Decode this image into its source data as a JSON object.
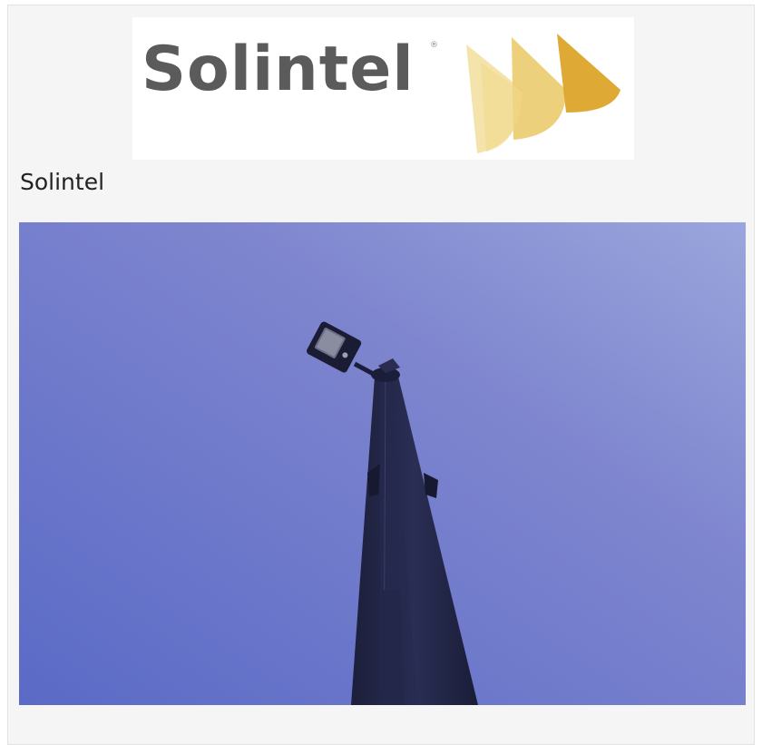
{
  "brand": {
    "logo_text": "Solintel",
    "logo_mark": "®",
    "name": "Solintel"
  },
  "photo": {
    "subject": "solar street lamp pole against blue sky"
  },
  "colors": {
    "logo_text": "#5b5b5b",
    "logo_gold_light": "#f0dc9c",
    "logo_gold_mid": "#e8c25a",
    "logo_gold_dark": "#d9a521",
    "sky_top": "#7a82c8",
    "sky_bottom": "#5f6dc4"
  }
}
